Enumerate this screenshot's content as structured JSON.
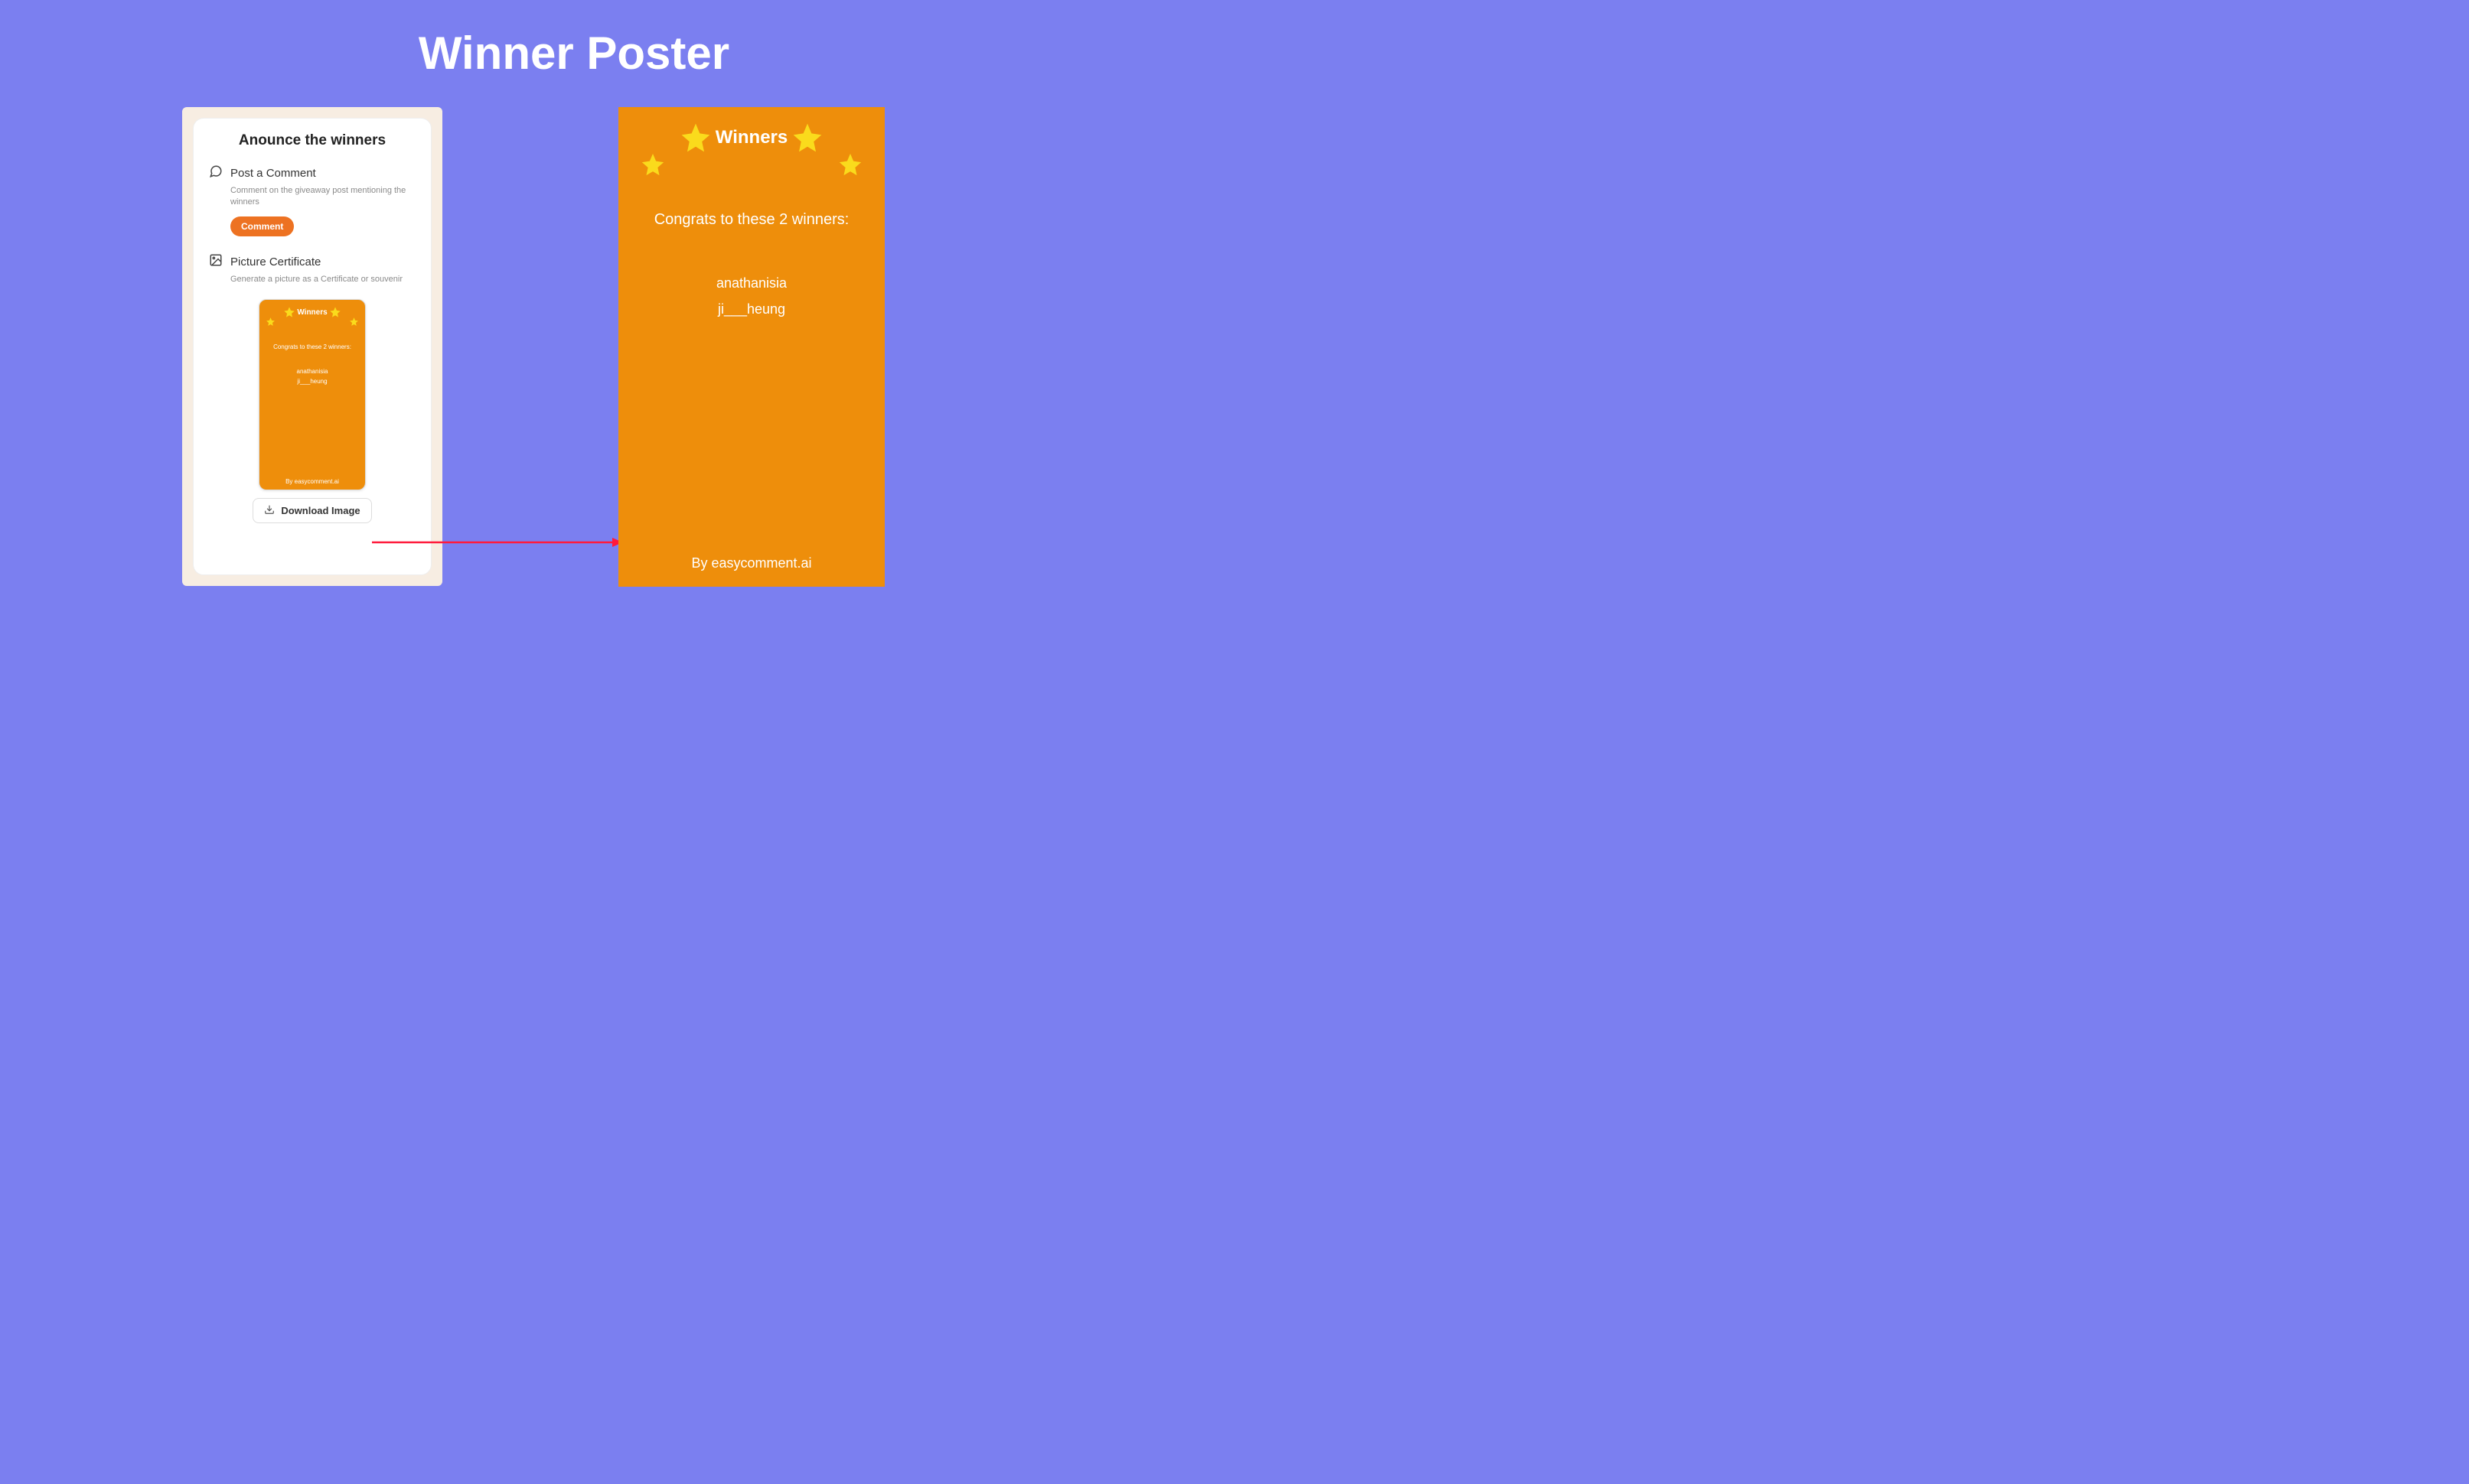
{
  "page": {
    "title": "Winner Poster"
  },
  "card": {
    "title": "Anounce the winners",
    "post": {
      "title": "Post a Comment",
      "desc": "Comment on the giveaway post mentioning the winners",
      "button": "Comment"
    },
    "certificate": {
      "title": "Picture Certificate",
      "desc": "Generate a picture as a Certificate or souvenir"
    },
    "download_button": "Download Image"
  },
  "poster": {
    "heading": "Winners",
    "subheading": "Congrats to these 2 winners:",
    "winners": [
      "anathanisia",
      "ji___heung"
    ],
    "footer": "By easycomment.ai"
  }
}
